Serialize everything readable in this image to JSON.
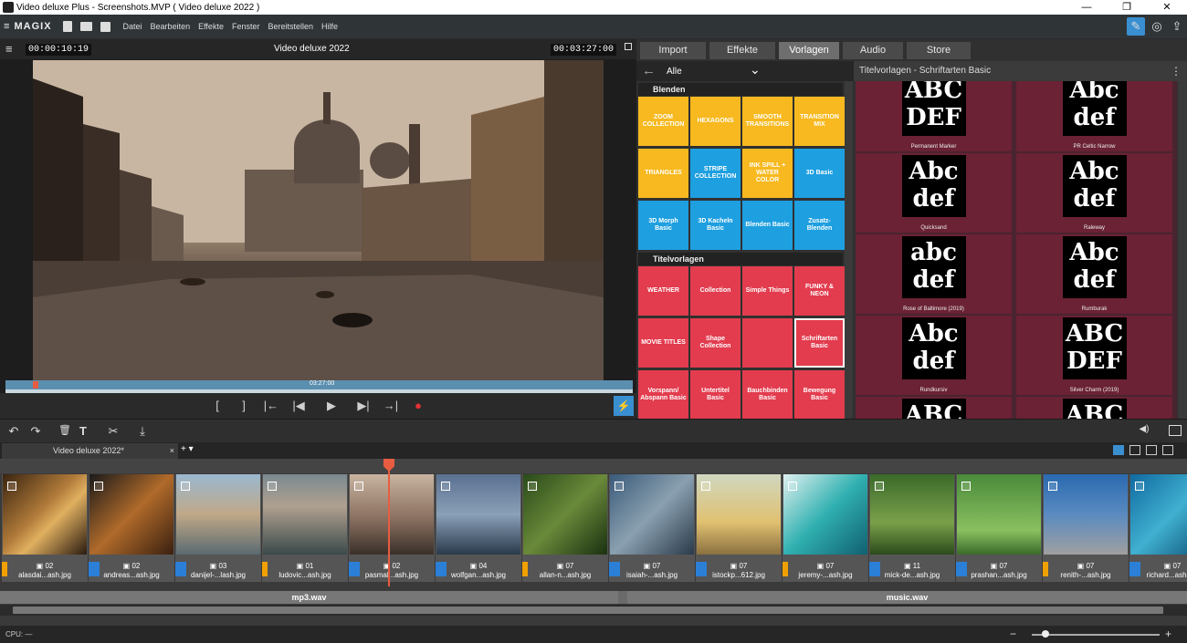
{
  "window": {
    "title": "Video deluxe Plus - Screenshots.MVP ( Video deluxe 2022 )",
    "minimize": "—",
    "restore": "❐",
    "close": "✕"
  },
  "menubar": {
    "logo": "≡ MAGIX",
    "items": [
      "Datei",
      "Bearbeiten",
      "Effekte",
      "Fenster",
      "Bereitstellen",
      "Hilfe"
    ]
  },
  "preview": {
    "timecode_left": "00:00:10:19",
    "title": "Video deluxe 2022",
    "timecode_right": "00:03:27:00",
    "seek_label": "03:27:00"
  },
  "transport": {
    "in": "[",
    "out": "]",
    "prev_marker": "|←",
    "prev": "|◀",
    "play": "▶",
    "next": "▶|",
    "next_marker": "→|",
    "record": "●"
  },
  "tabs": [
    "Import",
    "Effekte",
    "Vorlagen",
    "Audio",
    "Store"
  ],
  "active_tab": "Vorlagen",
  "category": {
    "back": "←",
    "label": "Alle",
    "dropdown": "⌄"
  },
  "category_header": "Titelvorlagen - Schriftarten Basic",
  "sections": {
    "blenden": {
      "label": "Blenden",
      "tiles": [
        {
          "label": "ZOOM COLLECTION",
          "color": "y"
        },
        {
          "label": "HEXAGONS",
          "color": "y"
        },
        {
          "label": "SMOOTH TRANSITIONS",
          "color": "y"
        },
        {
          "label": "TRANSITION MIX",
          "color": "y"
        },
        {
          "label": "TRIANGLES",
          "color": "y"
        },
        {
          "label": "STRIPE COLLECTION",
          "color": "b"
        },
        {
          "label": "INK SPILL + WATER COLOR",
          "color": "y"
        },
        {
          "label": "3D Basic",
          "color": "b"
        },
        {
          "label": "3D Morph Basic",
          "color": "b"
        },
        {
          "label": "3D Kacheln Basic",
          "color": "b"
        },
        {
          "label": "Blenden Basic",
          "color": "b"
        },
        {
          "label": "Zusatz-Blenden",
          "color": "b"
        }
      ]
    },
    "titel": {
      "label": "Titelvorlagen",
      "tiles": [
        {
          "label": "WEATHER",
          "color": "r"
        },
        {
          "label": "Collection",
          "color": "r"
        },
        {
          "label": "Simple Things",
          "color": "r"
        },
        {
          "label": "FUNKY & NEON",
          "color": "r"
        },
        {
          "label": "MOVIE TITLES",
          "color": "r"
        },
        {
          "label": "Shape Collection",
          "color": "r"
        },
        {
          "label": "",
          "color": "r"
        },
        {
          "label": "Schriftarten Basic",
          "color": "r"
        },
        {
          "label": "Vorspann/ Abspann Basic",
          "color": "r"
        },
        {
          "label": "Untertitel Basic",
          "color": "r"
        },
        {
          "label": "Bauchbinden Basic",
          "color": "r"
        },
        {
          "label": "Bewegung Basic",
          "color": "r"
        }
      ]
    }
  },
  "fonts": [
    {
      "preview": "ABC DEF",
      "name": "Permanent Marker"
    },
    {
      "preview": "Abc def",
      "name": "PR Celtic Narrow"
    },
    {
      "preview": "Abc def",
      "name": "Quicksand"
    },
    {
      "preview": "Abc def",
      "name": "Raleway"
    },
    {
      "preview": "abc def",
      "name": "Rose of Baltimore (2019)"
    },
    {
      "preview": "Abc def",
      "name": "Rumburak"
    },
    {
      "preview": "Abc def",
      "name": "Rundkursiv"
    },
    {
      "preview": "ABC DEF",
      "name": "Silver Charm (2019)"
    },
    {
      "preview": "ABC",
      "name": ""
    },
    {
      "preview": "ABC",
      "name": ""
    }
  ],
  "toolbar": {
    "undo": "↶",
    "redo": "↷",
    "delete": "🗑",
    "title": "T",
    "cut": "✂",
    "export": "⤓",
    "volume": "◀)"
  },
  "project_tab": {
    "label": "Video deluxe 2022*",
    "close": "×",
    "add": "+ ▾"
  },
  "clips": [
    {
      "num": "02",
      "name": "alasdai...ash.jpg",
      "img": "linear-gradient(135deg,#3a2410,#b07a3a 45%,#e0b060 60%,#2a1a10)"
    },
    {
      "num": "02",
      "name": "andreas...ash.jpg",
      "img": "linear-gradient(135deg,#1a1a1a,#b06a2a 50%,#3a2010)"
    },
    {
      "num": "03",
      "name": "danijel-...lash.jpg",
      "img": "linear-gradient(180deg,#9ab8d0 0%,#c0a888 50%,#5a6a70 100%)"
    },
    {
      "num": "01",
      "name": "ludovic...ash.jpg",
      "img": "linear-gradient(180deg,#7a8a90 0%,#b0a090 40%,#3a4a4a 100%)"
    },
    {
      "num": "02",
      "name": "pasmal...ash.jpg",
      "img": "linear-gradient(180deg,#c8b4a0 0%,#8a7060 55%,#3a302a 100%)"
    },
    {
      "num": "04",
      "name": "wolfgan...ash.jpg",
      "img": "linear-gradient(180deg,#5a7090 0%,#8aa0b8 50%,#2a3a4a 100%)"
    },
    {
      "num": "07",
      "name": "allan-n...ash.jpg",
      "img": "linear-gradient(135deg,#2a4a1a,#6a8a3a 50%,#1a3010)"
    },
    {
      "num": "07",
      "name": "isaiah-...ash.jpg",
      "img": "linear-gradient(135deg,#3a5a7a,#8aa0b0 50%,#2a3a4a)"
    },
    {
      "num": "07",
      "name": "istockp...612.jpg",
      "img": "linear-gradient(180deg,#d0d8c0 0%,#e0c070 60%,#8a7040 100%)"
    },
    {
      "num": "07",
      "name": "jeremy-...ash.jpg",
      "img": "linear-gradient(135deg,#e0f0f0,#30b0b0 50%,#106070)"
    },
    {
      "num": "11",
      "name": "mick-de...ash.jpg",
      "img": "linear-gradient(180deg,#3a6a2a 0%,#7aa04a 60%,#2a4a1a 100%)"
    },
    {
      "num": "07",
      "name": "prashan...ash.jpg",
      "img": "linear-gradient(180deg,#4a8a3a 0%,#8ac060 70%,#3a6a2a 100%)"
    },
    {
      "num": "07",
      "name": "renith-...ash.jpg",
      "img": "linear-gradient(180deg,#2a6ab0 0%,#5a8ac0 50%,#a0a0a0 100%)"
    },
    {
      "num": "07",
      "name": "richard...ash.jpg",
      "img": "linear-gradient(135deg,#106aa0,#40b0d0 50%,#0a4a70)"
    }
  ],
  "audio": [
    {
      "label": "mp3.wav"
    },
    {
      "label": "music.wav"
    }
  ],
  "status": {
    "cpu": "CPU: —"
  }
}
